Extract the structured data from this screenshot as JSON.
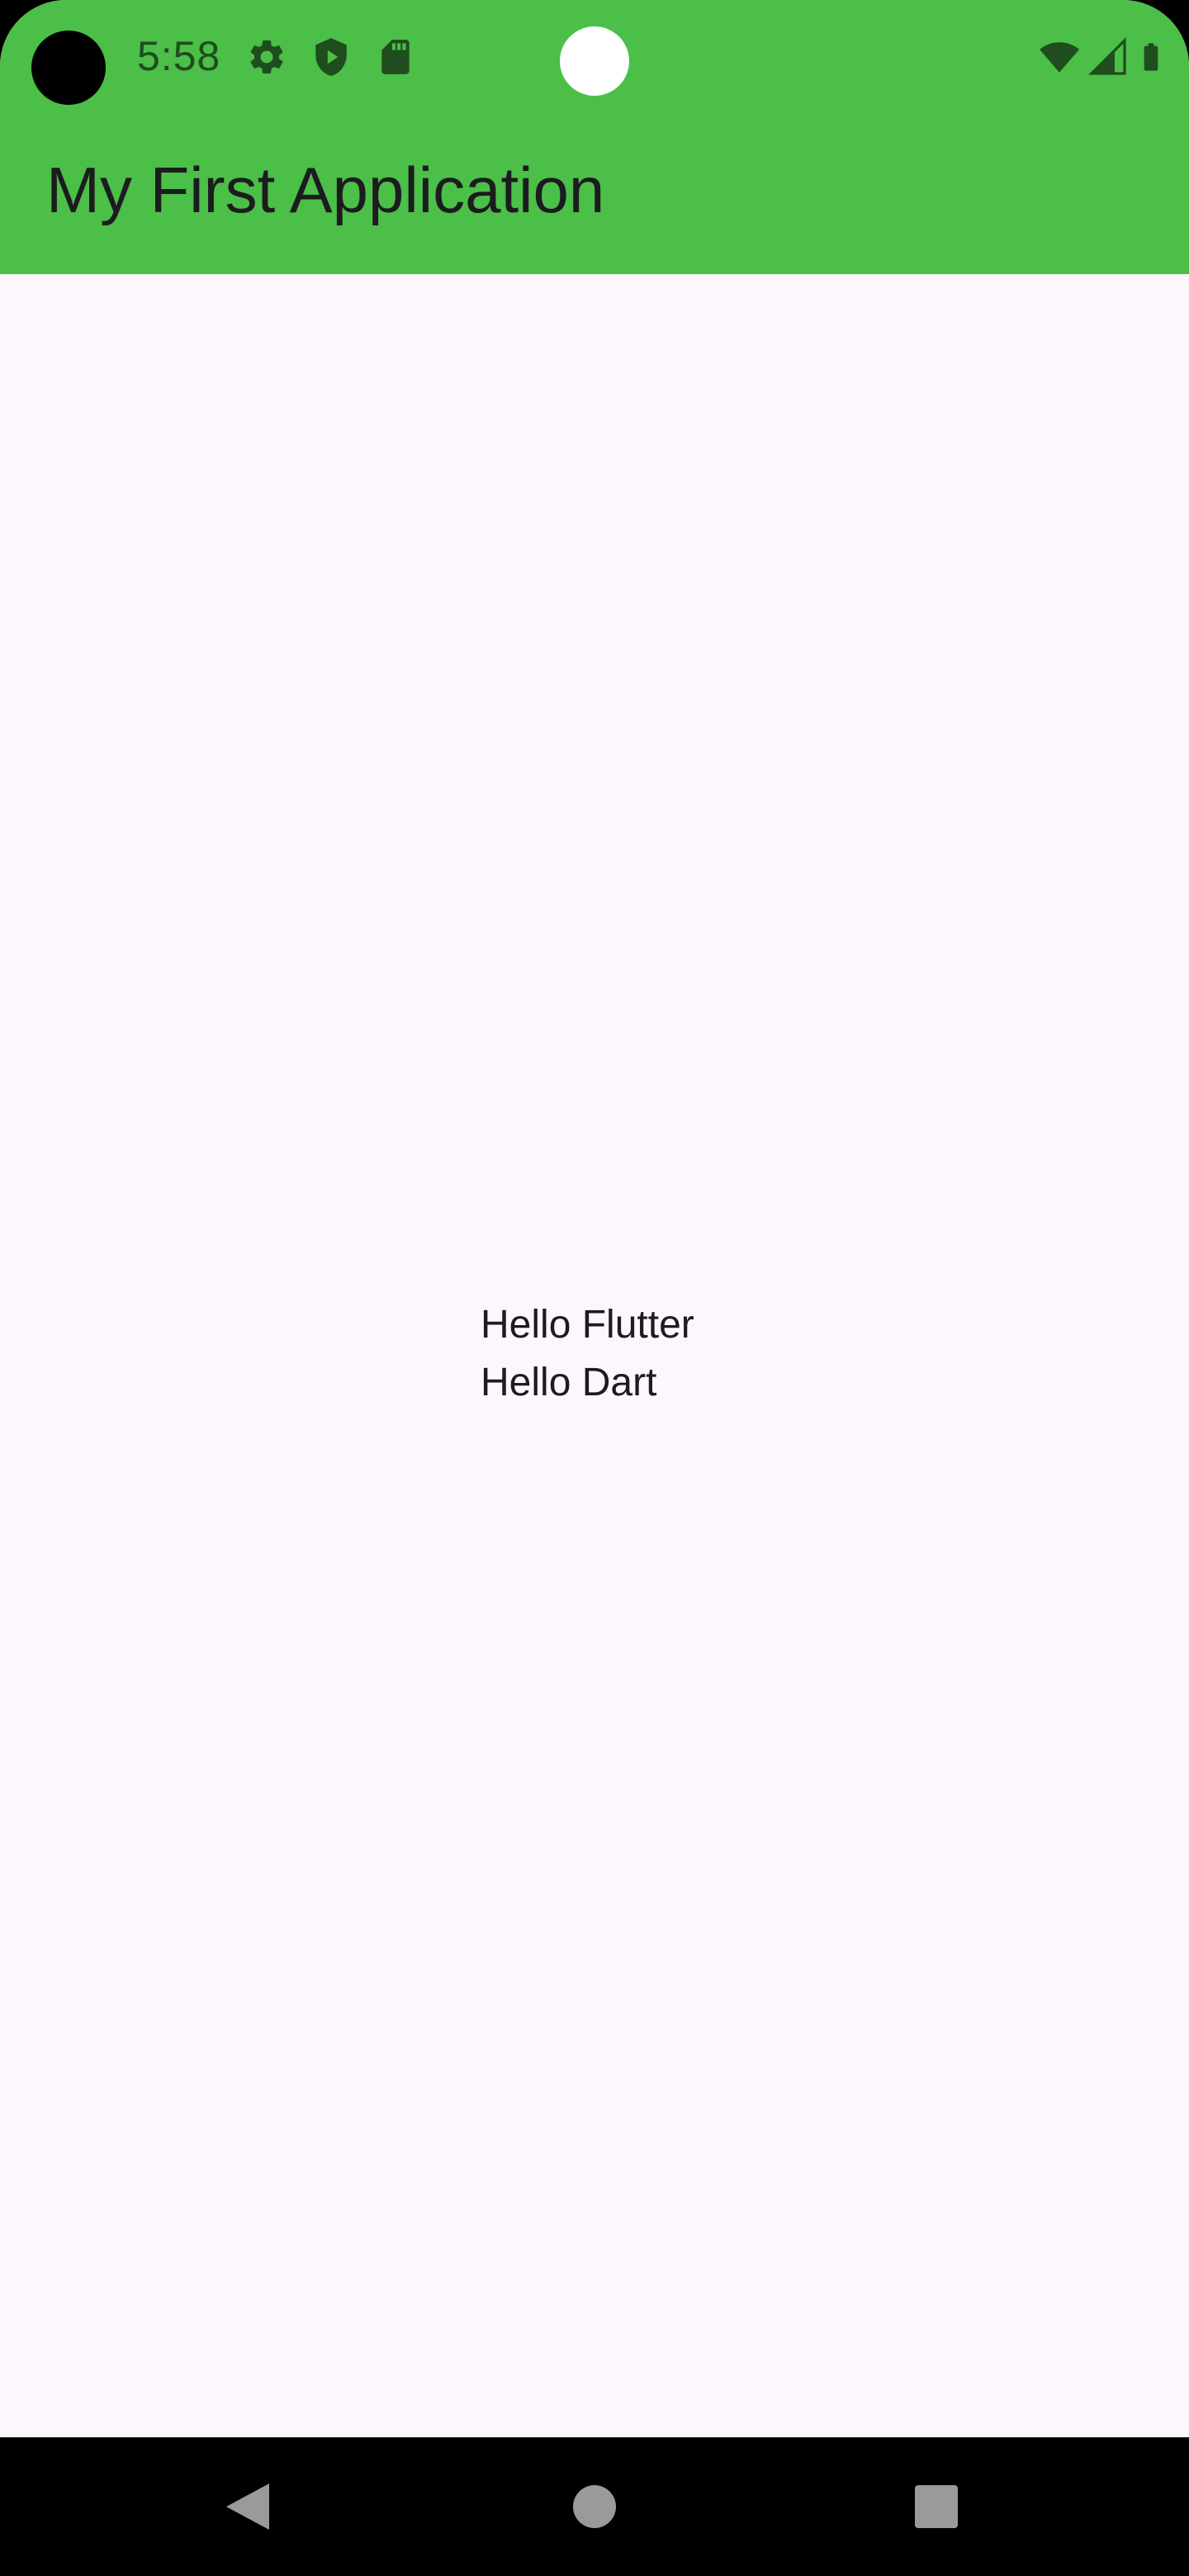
{
  "status_bar": {
    "time": "5:58",
    "left_icons": [
      "gear-icon",
      "shield-play-icon",
      "sd-card-icon"
    ],
    "right_icons": [
      "wifi-icon",
      "cell-signal-icon",
      "battery-icon"
    ],
    "icon_color": "#1f4d1e"
  },
  "app_bar": {
    "title": "My First Application",
    "background": "#4bbf47"
  },
  "body": {
    "lines": [
      "Hello Flutter",
      "Hello Dart"
    ],
    "background": "#fdf7fd"
  },
  "nav_bar": {
    "buttons": [
      "back-icon",
      "home-icon",
      "recents-icon"
    ]
  }
}
